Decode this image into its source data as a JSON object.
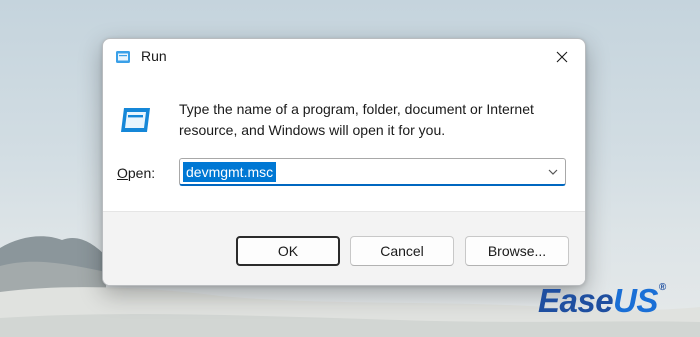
{
  "window": {
    "title": "Run"
  },
  "dialog": {
    "description": "Type the name of a program, folder, document or Internet resource, and Windows will open it for you.",
    "open_label_mnemonic": "O",
    "open_label_rest": "pen:",
    "open_value": "devmgmt.msc"
  },
  "buttons": {
    "ok": "OK",
    "cancel": "Cancel",
    "browse": "Browse..."
  },
  "branding": {
    "part1": "Ease",
    "part2": "US",
    "mark": "®"
  },
  "icons": {
    "title": "run-icon",
    "dialog": "run-large-icon",
    "close": "close-icon",
    "dropdown": "chevron-down-icon"
  },
  "colors": {
    "accent": "#0078d4",
    "brand": "#1f4fa0"
  }
}
